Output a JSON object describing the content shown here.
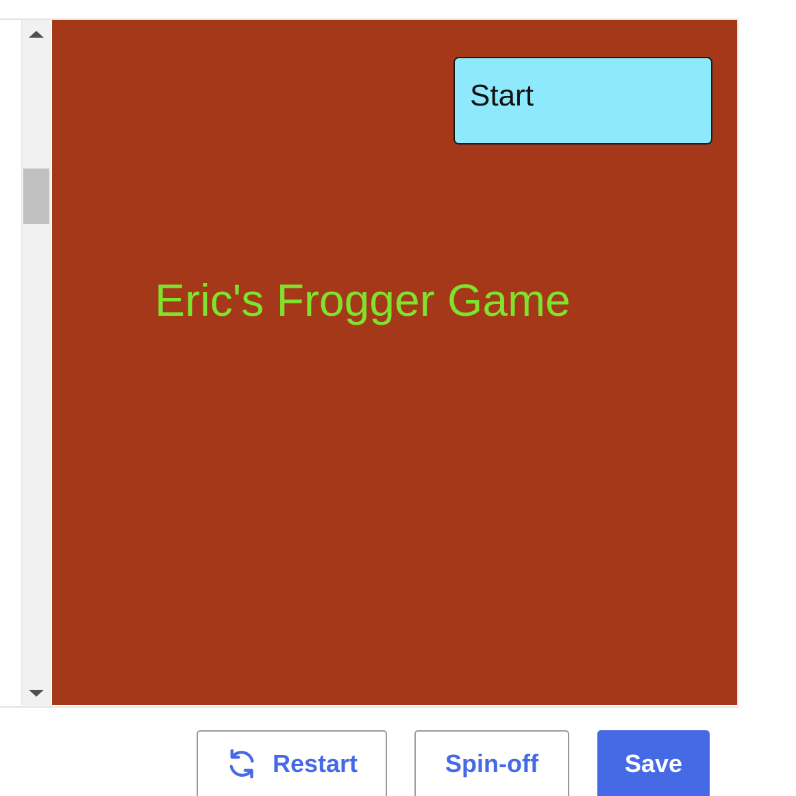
{
  "game": {
    "start_label": "Start",
    "title": "Eric's Frogger Game",
    "colors": {
      "canvas_background": "#a43818",
      "start_button": "#8ee9fc",
      "title_text": "#7fe32e"
    }
  },
  "toolbar": {
    "restart_label": "Restart",
    "restart_icon": "refresh-icon",
    "spinoff_label": "Spin-off",
    "save_label": "Save",
    "accent_color": "#4669e6"
  },
  "scrollbar": {
    "up_icon": "arrow-up-icon",
    "down_icon": "arrow-down-icon"
  }
}
